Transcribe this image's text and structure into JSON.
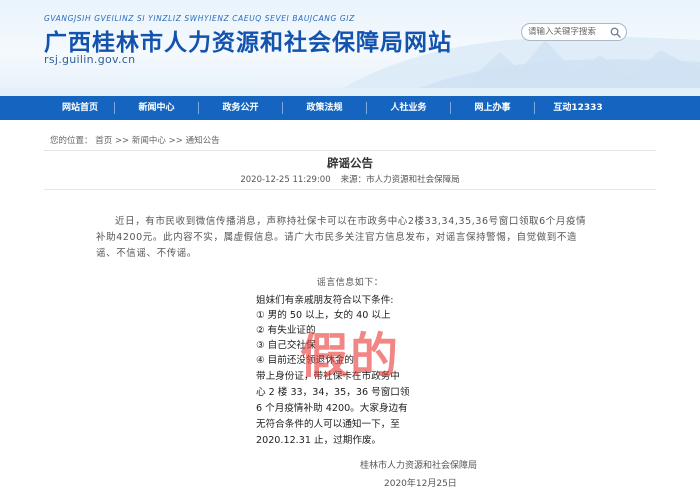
{
  "header": {
    "pinyin": "GVANGJSIH GVEILINZ SI YINZLIZ SWHYIENZ CAEUQ SEVEI BAUJCANG GIZ",
    "title": "广西桂林市人力资源和社会保障局网站",
    "domain": "rsj.guilin.gov.cn",
    "search_placeholder": "请输入关键字搜索"
  },
  "nav": {
    "items": [
      "网站首页",
      "新闻中心",
      "政务公开",
      "政策法规",
      "人社业务",
      "网上办事",
      "互动12333"
    ]
  },
  "breadcrumb": {
    "prefix": "您的位置：",
    "items": [
      "首页",
      "新闻中心",
      "通知公告"
    ],
    "separator": " >> "
  },
  "article": {
    "title": "辟谣公告",
    "date": "2020-12-25 11:29:00",
    "source": "来源：市人力资源和社会保障局",
    "paragraph": "近日，有市民收到微信传播消息，声称持社保卡可以在市政务中心2楼33,34,35,36号窗口领取6个月疫情补助4200元。此内容不实，属虚假信息。请广大市民多关注官方信息发布，对谣言保持警惕，自觉做到不造谣、不信谣、不传谣。",
    "rumor_label": "谣言信息如下：",
    "rumor_image": {
      "lines": [
        "姐妹们有亲戚朋友符合以下条件:",
        "① 男的 50 以上，女的 40 以上",
        "② 有失业证的",
        "③ 自己交社保",
        "④ 目前还没领退休金的",
        "带上身份证，带社保卡在市政务中",
        "心 2 楼 33，34，35，36 号窗口领",
        "6 个月疫情补助 4200。大家身边有",
        "无符合条件的人可以通知一下，至",
        "2020.12.31 止，过期作废。"
      ],
      "stamp": "假的"
    },
    "sign_org": "桂林市人力资源和社会保障局",
    "sign_date": "2020年12月25日"
  },
  "colors": {
    "nav_bg": "#1565c0",
    "title_blue": "#1353ad",
    "stamp_red": "#e83c38"
  }
}
